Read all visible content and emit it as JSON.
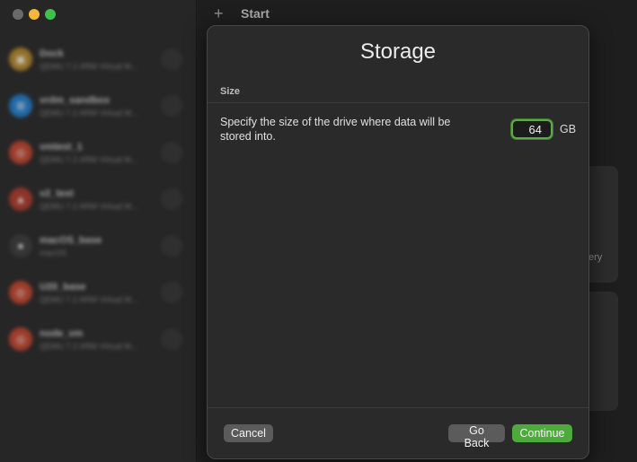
{
  "window": {
    "title": "Start"
  },
  "sidebar": {
    "vms": [
      {
        "name": "Dock",
        "subtitle": "QEMU 7.2 ARM Virtual M...",
        "os_color": "#b88a2a",
        "os_icon": "box-icon"
      },
      {
        "name": "vrdm_sandbox",
        "subtitle": "QEMU 7.2 ARM Virtual M...",
        "os_color": "#1f7fd1",
        "os_icon": "windows-icon"
      },
      {
        "name": "vmtest_1",
        "subtitle": "QEMU 7.2 ARM Virtual M...",
        "os_color": "#c7442d",
        "os_icon": "ubuntu-icon"
      },
      {
        "name": "v2_test",
        "subtitle": "QEMU 7.2 ARM Virtual M...",
        "os_color": "#b23a2b",
        "os_icon": "redhat-icon"
      },
      {
        "name": "macOS_base",
        "subtitle": "macOS",
        "os_color": "#3a3a3a",
        "os_icon": "apple-icon"
      },
      {
        "name": "U20_base",
        "subtitle": "QEMU 7.2 ARM Virtual M...",
        "os_color": "#c7442d",
        "os_icon": "ubuntu-icon"
      },
      {
        "name": "node_vm",
        "subtitle": "QEMU 7.2 ARM Virtual M...",
        "os_color": "#c7442d",
        "os_icon": "ubuntu-icon"
      }
    ]
  },
  "background": {
    "gallery_fragment": "ery"
  },
  "dialog": {
    "title": "Storage",
    "section": "Size",
    "description": "Specify the size of the drive where data will be stored into.",
    "size_value": "64",
    "unit": "GB",
    "buttons": {
      "cancel": "Cancel",
      "back": "Go Back",
      "continue": "Continue"
    }
  },
  "colors": {
    "accent": "#4faa3d",
    "focus_ring": "#5ea84a"
  }
}
